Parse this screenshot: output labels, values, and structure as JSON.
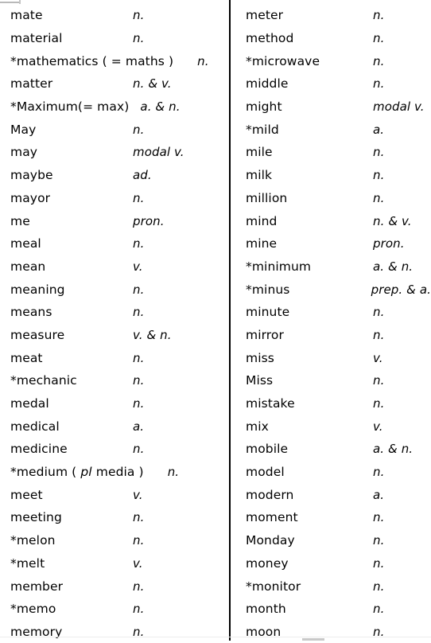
{
  "document": {
    "type": "vocabulary-word-list",
    "letter_section": "M",
    "columns": 2,
    "divider_color": "#000000",
    "text_color": "#000000",
    "background_color": "#ffffff",
    "note": "Asterisk (*) prefix marks starred entries; italic tags are parts of speech."
  },
  "legend": {
    "n": "n.",
    "v": "v.",
    "a": "a.",
    "ad": "ad.",
    "pron": "pron.",
    "prep": "prep.",
    "modal_v": "modal v."
  },
  "left_column": {
    "entries": [
      {
        "word": "mate",
        "pos": "n."
      },
      {
        "word": "material",
        "pos": "n."
      },
      {
        "word": "*mathematics ( = maths )",
        "pos": "n.",
        "width": "wide-lg"
      },
      {
        "word": "matter",
        "pos": "n. & v."
      },
      {
        "word": "*Maximum(= max)",
        "pos": "a. & n.",
        "width": "wide"
      },
      {
        "word": "May",
        "pos": "n."
      },
      {
        "word": "may",
        "pos": "modal v."
      },
      {
        "word": "maybe",
        "pos": "ad."
      },
      {
        "word": "mayor",
        "pos": "n."
      },
      {
        "word": "me",
        "pos": "pron."
      },
      {
        "word": "meal",
        "pos": "n."
      },
      {
        "word": "mean",
        "pos": "v."
      },
      {
        "word": "meaning",
        "pos": "n."
      },
      {
        "word": "means",
        "pos": "n."
      },
      {
        "word": "measure",
        "pos": "v. & n."
      },
      {
        "word": "meat",
        "pos": "n."
      },
      {
        "word": "*mechanic",
        "pos": "n."
      },
      {
        "word": "medal",
        "pos": "n."
      },
      {
        "word": "medical",
        "pos": "a."
      },
      {
        "word": "medicine",
        "pos": "n."
      },
      {
        "word": "*medium ( pl media )",
        "pos": "n.",
        "width": "wide-lg",
        "italic_part": "pl"
      },
      {
        "word": "meet",
        "pos": "v."
      },
      {
        "word": "meeting",
        "pos": "n."
      },
      {
        "word": "*melon",
        "pos": "n."
      },
      {
        "word": "*melt",
        "pos": "v."
      },
      {
        "word": "member",
        "pos": "n."
      },
      {
        "word": "*memo",
        "pos": "n."
      },
      {
        "word": "memory",
        "pos": "n."
      }
    ]
  },
  "right_column": {
    "entries": [
      {
        "word": "meter",
        "pos": "n."
      },
      {
        "word": "method",
        "pos": "n."
      },
      {
        "word": "*microwave",
        "pos": "n."
      },
      {
        "word": "middle",
        "pos": "n."
      },
      {
        "word": "might",
        "pos": "modal v."
      },
      {
        "word": "*mild",
        "pos": "a."
      },
      {
        "word": "mile",
        "pos": "n."
      },
      {
        "word": "milk",
        "pos": "n."
      },
      {
        "word": "million",
        "pos": "n."
      },
      {
        "word": "mind",
        "pos": "n. & v."
      },
      {
        "word": "mine",
        "pos": "pron."
      },
      {
        "word": "*minimum",
        "pos": "a. & n."
      },
      {
        "word": "*minus",
        "pos": "prep. & a."
      },
      {
        "word": "minute",
        "pos": "n."
      },
      {
        "word": "mirror",
        "pos": "n."
      },
      {
        "word": "miss",
        "pos": "v."
      },
      {
        "word": "Miss",
        "pos": "n."
      },
      {
        "word": "mistake",
        "pos": "n."
      },
      {
        "word": "mix",
        "pos": "v."
      },
      {
        "word": "mobile",
        "pos": "a. & n."
      },
      {
        "word": "model",
        "pos": "n."
      },
      {
        "word": "modern",
        "pos": "a."
      },
      {
        "word": "moment",
        "pos": "n."
      },
      {
        "word": "Monday",
        "pos": "n."
      },
      {
        "word": "money",
        "pos": "n."
      },
      {
        "word": "*monitor",
        "pos": "n."
      },
      {
        "word": "month",
        "pos": "n."
      },
      {
        "word": "moon",
        "pos": "n."
      }
    ]
  }
}
